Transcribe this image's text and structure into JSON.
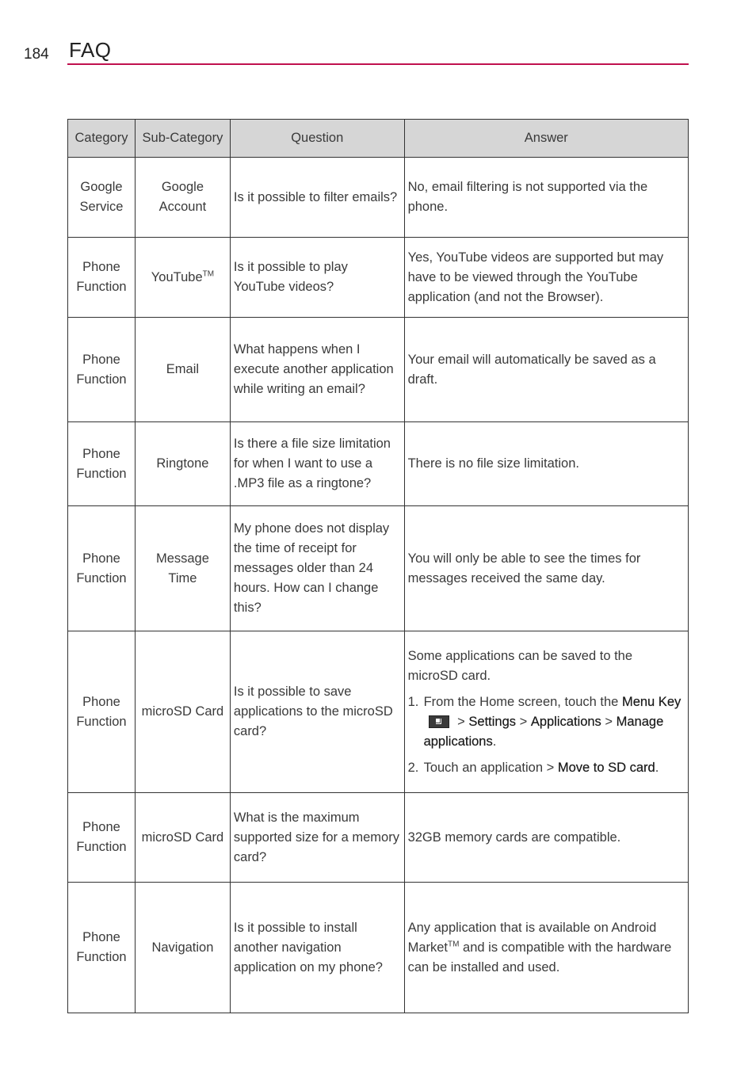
{
  "header": {
    "page_number": "184",
    "title": "FAQ",
    "accent_color": "#c0104e"
  },
  "table": {
    "columns": [
      "Category",
      "Sub-Category",
      "Question",
      "Answer"
    ],
    "rows": [
      {
        "category": [
          "Google",
          "Service"
        ],
        "subcategory": [
          "Google",
          "Account"
        ],
        "question": "Is it possible to filter emails?",
        "answer": "No, email filtering is not supported via the phone."
      },
      {
        "category": [
          "Phone",
          "Function"
        ],
        "subcategory": [
          "YouTube"
        ],
        "subcategory_sup": "TM",
        "question": "Is it possible to play YouTube videos?",
        "answer": "Yes, YouTube videos are supported but may have to be viewed through the YouTube application (and not the Browser)."
      },
      {
        "category": [
          "Phone",
          "Function"
        ],
        "subcategory": [
          "Email"
        ],
        "question": "What happens when I execute another application while writing an email?",
        "answer": "Your email will automatically be saved as a draft."
      },
      {
        "category": [
          "Phone",
          "Function"
        ],
        "subcategory": [
          "Ringtone"
        ],
        "question": "Is there a file size limitation for when I want to use a .MP3 file as a ringtone?",
        "answer": "There is no file size limitation."
      },
      {
        "category": [
          "Phone",
          "Function"
        ],
        "subcategory": [
          "Message",
          "Time"
        ],
        "question": "My phone does not display the time of receipt for messages older than 24 hours. How can I change this?",
        "answer": "You will only be able to see the times for messages received the same day."
      },
      {
        "category": [
          "Phone",
          "Function"
        ],
        "subcategory": [
          "microSD Card"
        ],
        "question": "Is it possible to save applications to the microSD card?",
        "answer_intro": "Some applications can be saved to the microSD card.",
        "steps": [
          {
            "num": "1.",
            "text1": "From the Home screen, touch the ",
            "b1": "Menu Key",
            "icon": "menu-key-icon",
            "sep1": " > ",
            "b2": "Settings",
            "sep2": " > ",
            "b3": "Applications",
            "sep3": " > ",
            "b4": "Manage applications",
            "end": "."
          },
          {
            "num": "2.",
            "text1": "Touch an application > ",
            "b1": "Move to SD card",
            "end": "."
          }
        ]
      },
      {
        "category": [
          "Phone",
          "Function"
        ],
        "subcategory": [
          "microSD Card"
        ],
        "question": "What is the maximum supported size for a memory card?",
        "answer": "32GB memory cards are compatible."
      },
      {
        "category": [
          "Phone",
          "Function"
        ],
        "subcategory": [
          "Navigation"
        ],
        "question": "Is it possible to install another navigation application on my phone?",
        "answer_pre": "Any application that is available on Android Market",
        "answer_sup": "TM",
        "answer_post": " and is compatible with the hardware can be installed and used."
      }
    ]
  }
}
